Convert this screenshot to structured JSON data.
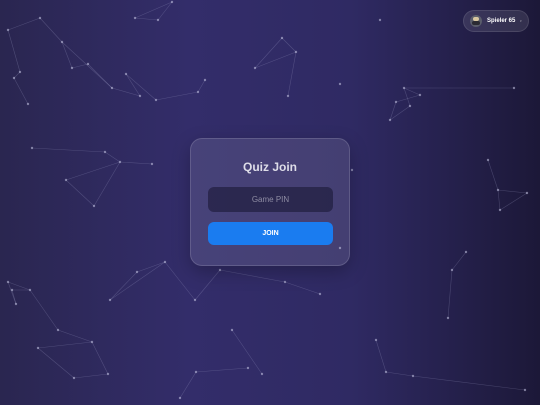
{
  "user": {
    "name": "Spieler 65"
  },
  "quiz": {
    "title": "Quiz Join",
    "pin_placeholder": "Game PIN",
    "join_label": "JOIN"
  },
  "colors": {
    "accent": "#1a7cf0",
    "background": "#2f2a63"
  }
}
